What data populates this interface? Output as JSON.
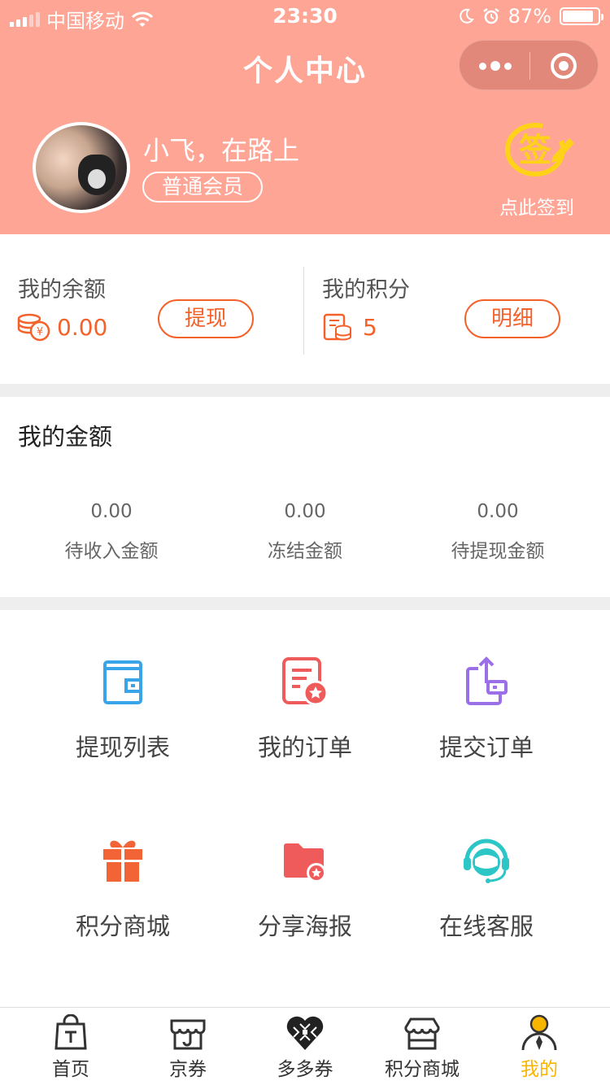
{
  "status_bar": {
    "carrier": "中国移动",
    "time": "23:30",
    "battery": "87%",
    "battery_level": 0.87
  },
  "header": {
    "title": "个人中心"
  },
  "profile": {
    "name": "小飞，在路上",
    "member_level": "普通会员",
    "signin_label": "点此签到",
    "signin_icon_text": "签"
  },
  "balance": {
    "title": "我的余额",
    "value": "0.00",
    "button": "提现"
  },
  "points": {
    "title": "我的积分",
    "value": "5",
    "button": "明细"
  },
  "amounts": {
    "title": "我的金额",
    "items": [
      {
        "value": "0.00",
        "label": "待收入金额"
      },
      {
        "value": "0.00",
        "label": "冻结金额"
      },
      {
        "value": "0.00",
        "label": "待提现金额"
      }
    ]
  },
  "menu": [
    {
      "label": "提现列表",
      "icon": "wallet-icon",
      "color": "#3aa4e8"
    },
    {
      "label": "我的订单",
      "icon": "order-star-icon",
      "color": "#ef5a5a"
    },
    {
      "label": "提交订单",
      "icon": "submit-order-icon",
      "color": "#9b6fe8"
    },
    {
      "label": "积分商城",
      "icon": "gift-icon",
      "color": "#f26436"
    },
    {
      "label": "分享海报",
      "icon": "folder-star-icon",
      "color": "#ef5a5a"
    },
    {
      "label": "在线客服",
      "icon": "customer-service-icon",
      "color": "#2cc6c6"
    }
  ],
  "tabs": [
    {
      "label": "首页",
      "icon": "bag-icon"
    },
    {
      "label": "京券",
      "icon": "shop-j-icon"
    },
    {
      "label": "多多券",
      "icon": "heart-pattern-icon"
    },
    {
      "label": "积分商城",
      "icon": "store-icon"
    },
    {
      "label": "我的",
      "icon": "user-icon",
      "active": true
    }
  ],
  "colors": {
    "header_bg": "#fea595",
    "accent": "#f5612a",
    "tab_active": "#f7b500"
  }
}
